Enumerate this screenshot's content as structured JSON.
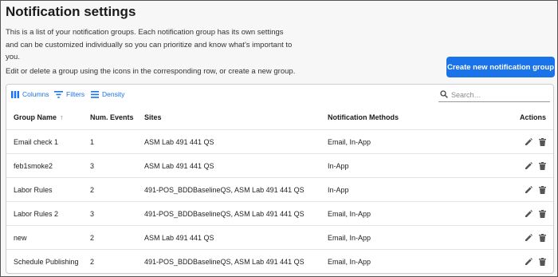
{
  "page": {
    "title": "Notification settings",
    "description": "This is a list of your notification groups. Each notification group has its own settings and can be customized individually so you can prioritize and know what's important to you.",
    "instructions": "Edit or delete a group using the icons in the corresponding row, or create a new group.",
    "create_button": "Create new notification group"
  },
  "toolbar": {
    "columns": "Columns",
    "filters": "Filters",
    "density": "Density",
    "search_placeholder": "Search…"
  },
  "table": {
    "headers": {
      "name": "Group Name",
      "events": "Num. Events",
      "sites": "Sites",
      "methods": "Notification Methods",
      "actions": "Actions"
    },
    "rows": [
      {
        "name": "Email check 1",
        "events": "1",
        "sites": "ASM Lab 491 441 QS",
        "methods": "Email, In-App"
      },
      {
        "name": "feb1smoke2",
        "events": "3",
        "sites": "ASM Lab 491 441 QS",
        "methods": "In-App"
      },
      {
        "name": "Labor Rules",
        "events": "2",
        "sites": "491-POS_BDDBaselineQS, ASM Lab 491 441 QS",
        "methods": "In-App"
      },
      {
        "name": "Labor Rules 2",
        "events": "3",
        "sites": "491-POS_BDDBaselineQS, ASM Lab 491 441 QS",
        "methods": "Email, In-App"
      },
      {
        "name": "new",
        "events": "2",
        "sites": "ASM Lab 491 441 QS",
        "methods": "Email, In-App"
      },
      {
        "name": "Schedule Publishing",
        "events": "2",
        "sites": "491-POS_BDDBaselineQS, ASM Lab 491 441 QS",
        "methods": "Email, In-App"
      }
    ]
  },
  "colors": {
    "accent": "#1a73e8",
    "icon_gray": "#555555"
  },
  "icons": {
    "columns": "columns-icon",
    "filters": "filter-icon",
    "density": "density-icon",
    "search": "search-icon",
    "sort": "arrow-up-icon",
    "edit": "pencil-icon",
    "delete": "trash-icon"
  }
}
